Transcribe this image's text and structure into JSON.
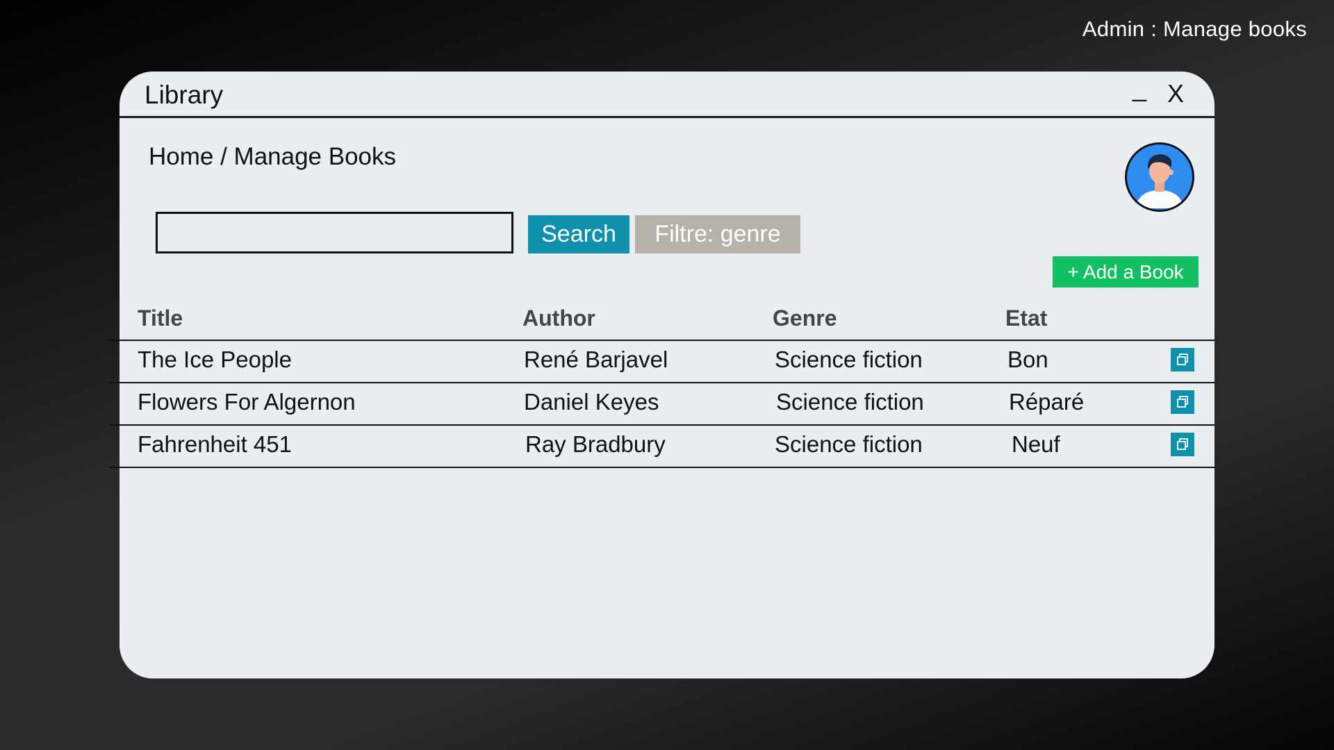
{
  "page_caption": "Admin : Manage books",
  "window": {
    "title": "Library",
    "minimize_label": "_",
    "close_label": "X"
  },
  "breadcrumb": "Home / Manage Books",
  "search": {
    "value": "",
    "placeholder": "",
    "button_label": "Search"
  },
  "filter": {
    "label": "Filtre: genre"
  },
  "add_book": {
    "label": "+ Add a Book"
  },
  "table": {
    "columns": [
      "Title",
      "Author",
      "Genre",
      "Etat"
    ],
    "rows": [
      [
        "The Ice People",
        "René Barjavel",
        "Science fiction",
        "Bon"
      ],
      [
        "Flowers For Algernon",
        "Daniel Keyes",
        "Science fiction",
        "Réparé"
      ],
      [
        "Fahrenheit 451",
        "Ray Bradbury",
        "Science fiction",
        "Neuf"
      ]
    ]
  },
  "icons": {
    "avatar": "user-avatar-icon",
    "row_action": "copy-icon"
  },
  "colors": {
    "search_button": "#0f90ad",
    "filter_button": "#b6b2a9",
    "add_button": "#10c061",
    "row_action": "#0f90ad",
    "window_bg": "#e9eef1"
  }
}
